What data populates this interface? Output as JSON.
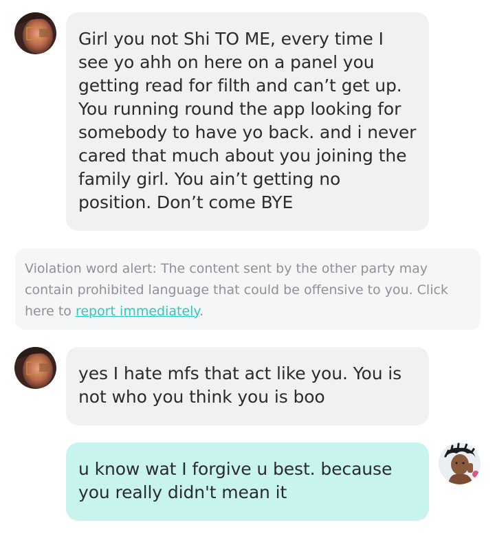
{
  "messages": [
    {
      "direction": "incoming",
      "avatar": "avatar-female-photo",
      "text": "Girl you not Shi TO ME, every time I see yo ahh on here on a panel you getting read for filth and can’t get up. You running round the app looking for somebody to have yo back. and i never cared that much about you joining the family girl. You ain’t getting no position. Don’t come BYE"
    },
    {
      "direction": "incoming",
      "avatar": "avatar-female-photo",
      "text": "yes I hate mfs that act like you. You is not who you think you is boo"
    },
    {
      "direction": "outgoing",
      "avatar": "avatar-male-photo",
      "text": "u know wat I forgive u best. because you really didn't mean it"
    }
  ],
  "violation_alert": {
    "text_before": "Violation word alert: The content sent by the other party may contain prohibited language that could be offensive to you. Click here to ",
    "link_text": "report immediately",
    "text_after": "."
  },
  "colors": {
    "incoming_bubble": "#f0f1f3",
    "outgoing_bubble": "#c7f4ee",
    "alert_background": "#f4f6f8",
    "alert_text": "#8e9196",
    "link": "#2ec9be",
    "message_text": "#2b2b2b"
  }
}
